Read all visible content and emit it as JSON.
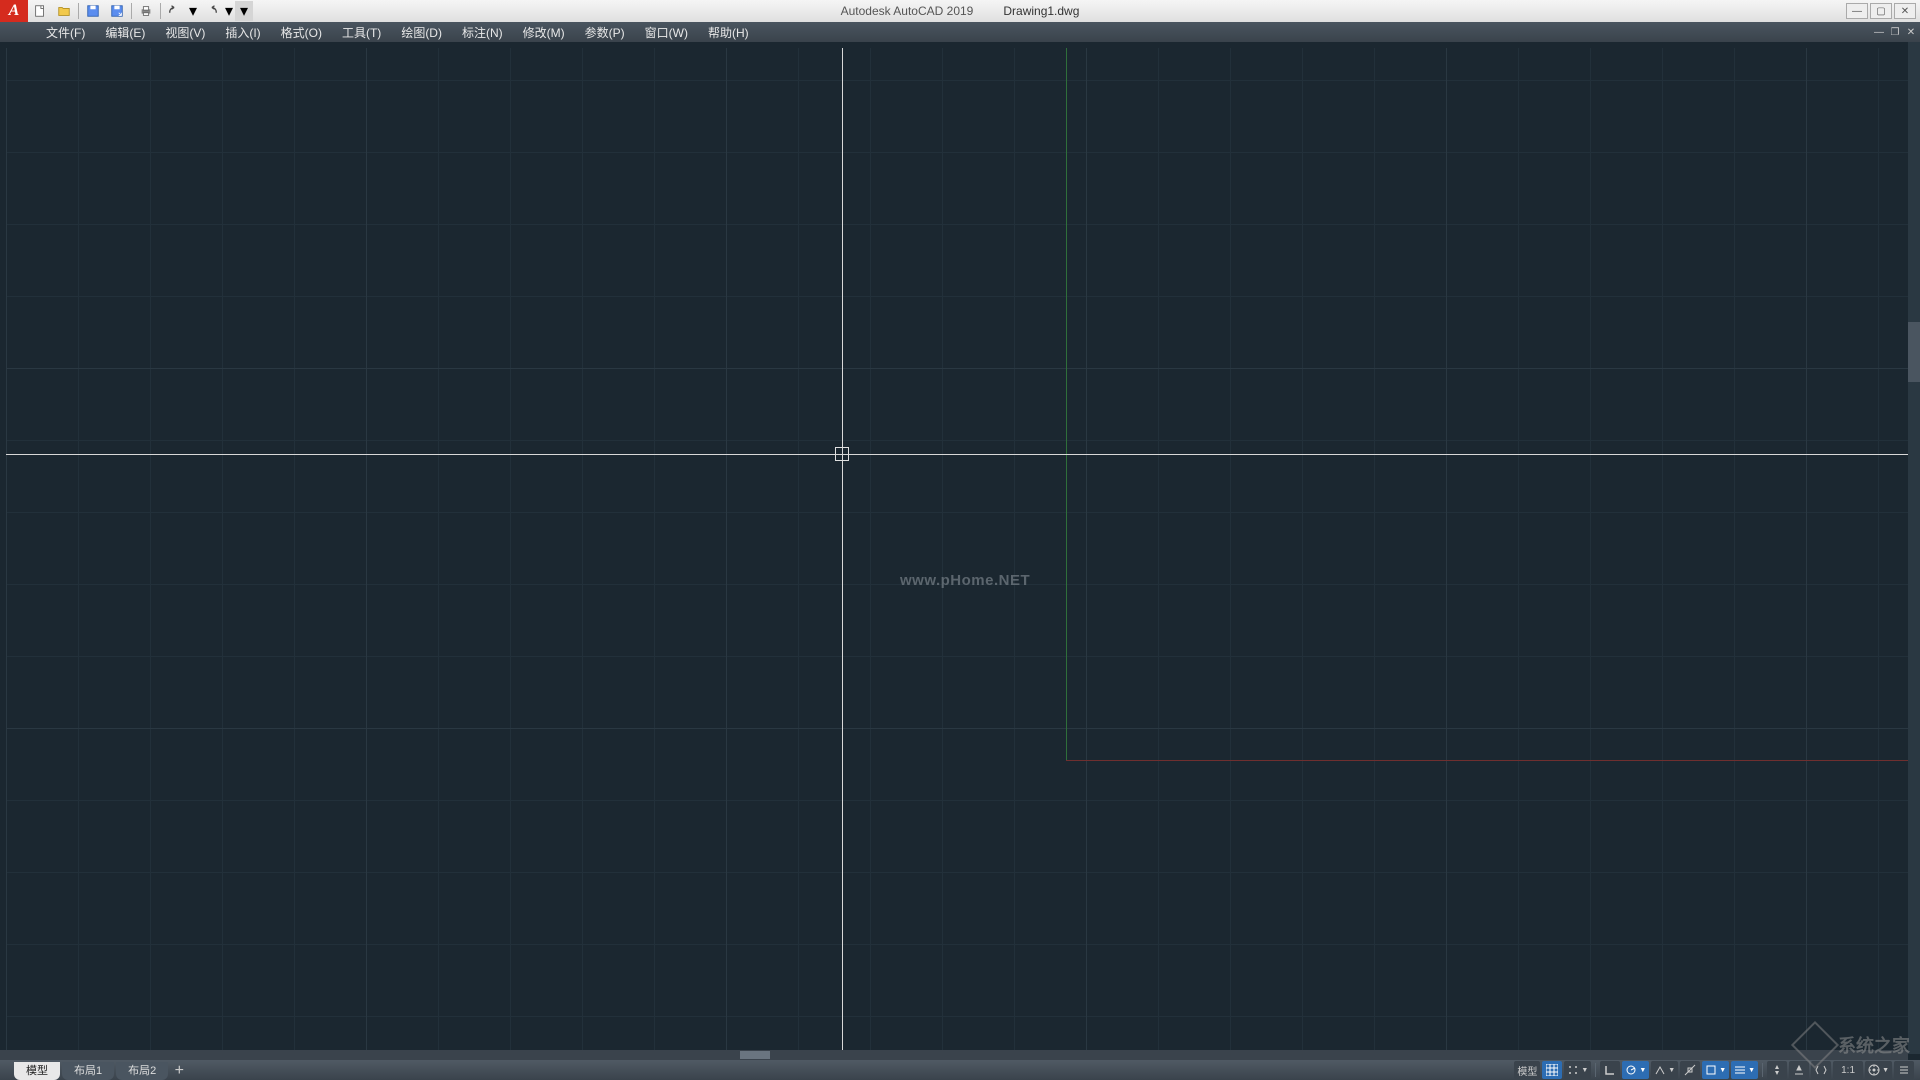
{
  "title": {
    "app": "Autodesk AutoCAD 2019",
    "file": "Drawing1.dwg"
  },
  "menubar": [
    "文件(F)",
    "编辑(E)",
    "视图(V)",
    "插入(I)",
    "格式(O)",
    "工具(T)",
    "绘图(D)",
    "标注(N)",
    "修改(M)",
    "参数(P)",
    "窗口(W)",
    "帮助(H)"
  ],
  "tabs": {
    "active": "模型",
    "items": [
      "模型",
      "布局1",
      "布局2"
    ]
  },
  "watermark": "www.pHome.NET",
  "statusbar": {
    "model": "模型",
    "scale": "1:1"
  },
  "brand": "系统之家"
}
